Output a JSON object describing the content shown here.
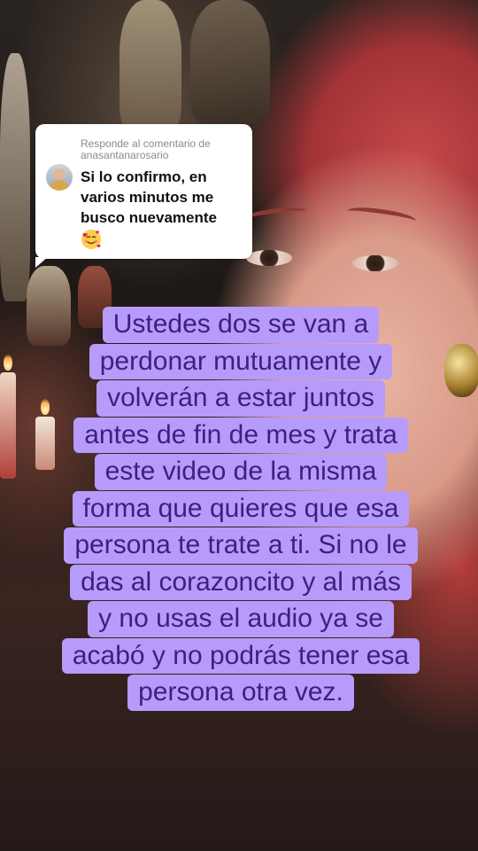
{
  "reply_card": {
    "label": "Responde al comentario de anasantanarosario",
    "comment_lines": [
      "Si lo confirmo, en",
      "varios minutos me",
      "busco nuevamente"
    ],
    "emoji": "smiling-face-with-hearts"
  },
  "caption": {
    "lines": [
      "Ustedes dos se van a",
      "perdonar mutuamente y",
      "volverán a estar juntos",
      "antes de fin de mes y trata",
      "este video de la misma",
      "forma que quieres que esa",
      "persona te trate a ti. Si no le",
      "das al corazoncito y al más",
      "y no usas el audio ya se",
      "acabó y no podrás tener esa",
      "persona otra vez."
    ],
    "bg_color": "#b69bfa",
    "text_color": "#3d1f82"
  }
}
